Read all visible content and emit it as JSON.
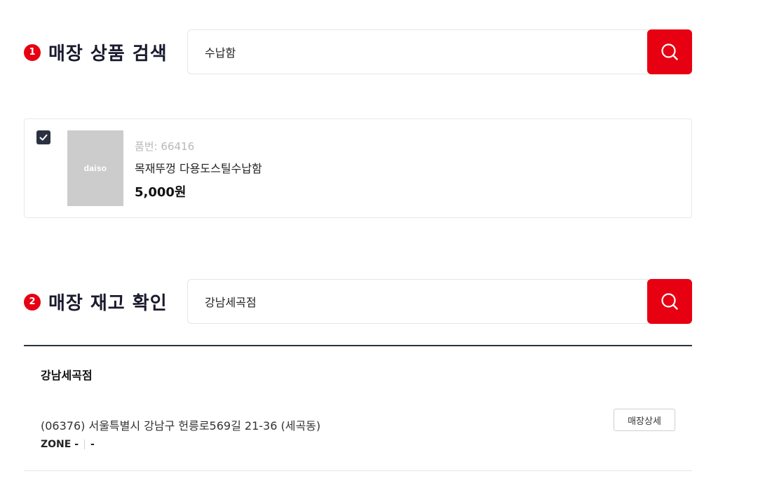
{
  "section1": {
    "step": "1",
    "title": "매장 상품 검색",
    "search_value": "수납함",
    "search_icon": "search-icon"
  },
  "product": {
    "checked": true,
    "thumb_logo": "daiso",
    "code": "품번: 66416",
    "name": "목재뚜껑 다용도스틸수납함",
    "price": "5,000원"
  },
  "section2": {
    "step": "2",
    "title": "매장 재고 확인",
    "search_value": "강남세곡점",
    "search_icon": "search-icon"
  },
  "store": {
    "name": "강남세곡점",
    "address": "(06376) 서울특별시 강남구 헌릉로569길 21-36 (세곡동)",
    "zone_label": "ZONE -",
    "zone_value": "-",
    "detail_button": "매장상세"
  },
  "colors": {
    "accent": "#e60012",
    "dark": "#2b3140"
  }
}
